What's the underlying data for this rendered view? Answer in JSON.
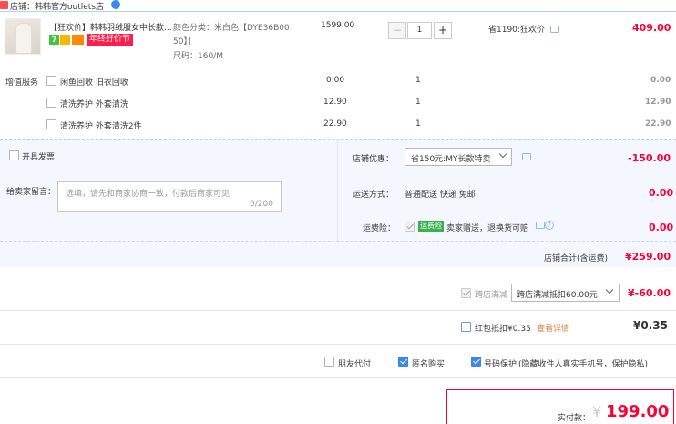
{
  "shop": {
    "label": "店铺：",
    "name": "韩韩官方outlets店"
  },
  "product": {
    "title": "【狂欢价】韩韩羽绒服女中长款...",
    "badge_seven": "7",
    "badge_promo": "年终好价节",
    "sku_color_line1": "颜色分类：米白色【DYE36B00",
    "sku_color_line2": "50】]",
    "sku_size": "尺码：160/M",
    "unit_price": "1599.00",
    "quantity": "1",
    "discount_note": "省1190:狂欢价",
    "total": "409.00"
  },
  "services": {
    "section_label": "增值服务",
    "items": [
      {
        "label": "闲鱼回收 旧衣回收",
        "price": "0.00",
        "qty": "1",
        "total": "0.00"
      },
      {
        "label": "清洗养护 外套清洗",
        "price": "12.90",
        "qty": "1",
        "total": "12.90"
      },
      {
        "label": "清洗养护 外套清洗2件",
        "price": "22.90",
        "qty": "1",
        "total": "22.90"
      }
    ]
  },
  "invoice_label": "开具发票",
  "message": {
    "label": "给卖家留言：",
    "placeholder": "选填，请先和商家协商一致，付款后商家可见",
    "counter": "0/200"
  },
  "shop_discount": {
    "label": "店铺优惠：",
    "selected": "省150元:MY长款特卖",
    "amount": "-150.00"
  },
  "shipping": {
    "label": "运送方式：",
    "value": "普通配送 快递 免邮",
    "amount": "0.00"
  },
  "insurance": {
    "label": "运费险：",
    "badge": "运费险",
    "text": "卖家赠送，退换货可赔",
    "amount": "0.00"
  },
  "shop_total": {
    "label": "店铺合计(含运费)",
    "amount": "¥259.00"
  },
  "cross_shop": {
    "label": "跨店满减",
    "selected": "跨店满减抵扣60.00元",
    "amount": "¥-60.00"
  },
  "red_packet": {
    "label": "红包抵扣¥0.35",
    "link": "查看详情",
    "amount": "¥0.35"
  },
  "options": {
    "friend_pay": "朋友代付",
    "anonymous": "匿名购买",
    "number_protect": "号码保护",
    "number_protect_note": "(隐藏收件人真实手机号，保护隐私)"
  },
  "payment": {
    "label": "实付款：",
    "currency": "¥",
    "amount": "199.00"
  },
  "colors": {
    "accent_red": "#ff0036",
    "checkbox_blue": "#3b88e9",
    "promo_bg": "#f4f7fd"
  }
}
